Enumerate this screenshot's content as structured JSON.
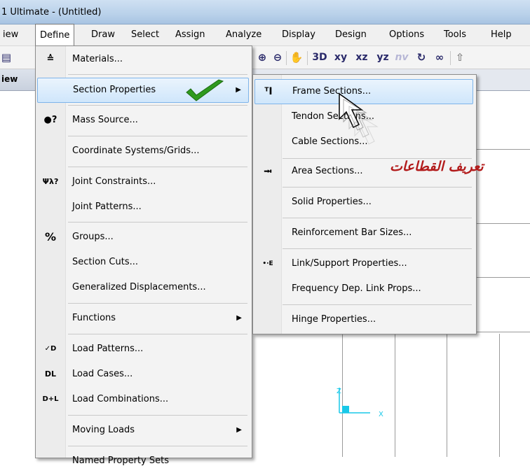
{
  "window": {
    "title": "1 Ultimate  - (Untitled)"
  },
  "menubar": {
    "items": [
      "iew",
      "Define",
      "Draw",
      "Select",
      "Assign",
      "Analyze",
      "Display",
      "Design",
      "Options",
      "Tools",
      "Help"
    ],
    "active": "Define"
  },
  "toolbar": {
    "buttons": [
      "zoom-in-icon",
      "zoom-out-icon",
      "pan-hand-icon",
      "3D",
      "xy",
      "xz",
      "yz",
      "nv",
      "rotate-icon",
      "perspective-icon",
      "up-arrow-icon"
    ],
    "labels": {
      "three_d": "3D",
      "xy": "xy",
      "xz": "xz",
      "yz": "yz",
      "nv": "nv"
    }
  },
  "view": {
    "tab_label": "iew"
  },
  "define_menu": {
    "items": [
      {
        "label": "Materials...",
        "icon": "materials-icon"
      },
      {
        "label": "Section Properties",
        "icon": "",
        "submenu": true,
        "highlighted": true
      },
      {
        "label": "Mass Source...",
        "icon": "mass-source-icon"
      },
      {
        "label": "Coordinate Systems/Grids...",
        "icon": ""
      },
      {
        "label": "Joint Constraints...",
        "icon": "joint-constraints-icon"
      },
      {
        "label": "Joint Patterns...",
        "icon": ""
      },
      {
        "label": "Groups...",
        "icon": "groups-icon"
      },
      {
        "label": "Section Cuts...",
        "icon": ""
      },
      {
        "label": "Generalized Displacements...",
        "icon": ""
      },
      {
        "label": "Functions",
        "icon": "",
        "submenu": true
      },
      {
        "label": "Load Patterns...",
        "icon": "load-patterns-icon"
      },
      {
        "label": "Load Cases...",
        "icon": "load-cases-icon"
      },
      {
        "label": "Load Combinations...",
        "icon": "load-combinations-icon"
      },
      {
        "label": "Moving Loads",
        "icon": "",
        "submenu": true
      },
      {
        "label": "Named Property Sets",
        "icon": ""
      }
    ]
  },
  "section_properties_menu": {
    "items": [
      {
        "label": "Frame Sections...",
        "icon": "frame-sections-icon",
        "highlighted": true
      },
      {
        "label": "Tendon Sections...",
        "icon": ""
      },
      {
        "label": "Cable Sections...",
        "icon": ""
      },
      {
        "label": "Area Sections...",
        "icon": "area-sections-icon"
      },
      {
        "label": "Solid Properties...",
        "icon": ""
      },
      {
        "label": "Reinforcement Bar Sizes...",
        "icon": ""
      },
      {
        "label": "Link/Support Properties...",
        "icon": "link-support-icon"
      },
      {
        "label": "Frequency Dep. Link Props...",
        "icon": ""
      },
      {
        "label": "Hinge Properties...",
        "icon": ""
      }
    ]
  },
  "annotation": {
    "text": "تعريف القطاعات",
    "color": "#b21a1a"
  },
  "colors": {
    "highlight_border": "#7eb4ea",
    "check_green": "#2f9a1e",
    "axis_cyan": "#19c8e8"
  }
}
